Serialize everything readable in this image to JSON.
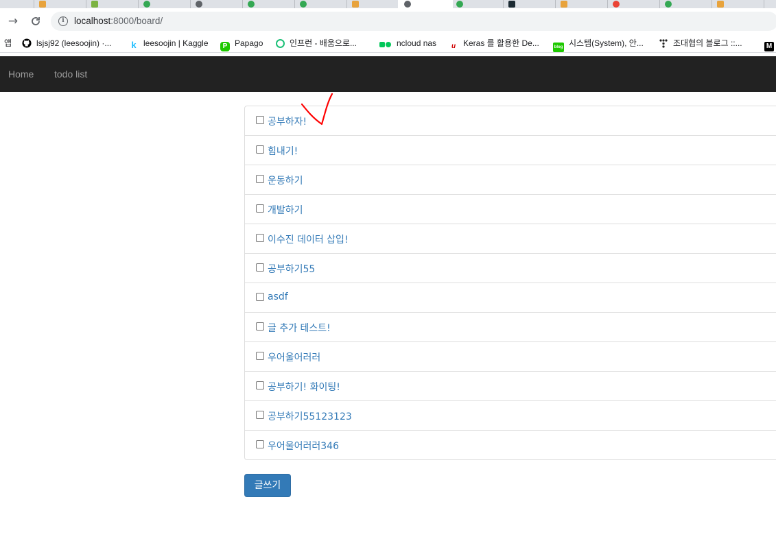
{
  "browser": {
    "url_host": "localhost",
    "url_path": ":8000/board/",
    "tab_favicon_colors": [
      "#e8a33c",
      "#e8a33c",
      "#7cb342",
      "#34a853",
      "#5f6368",
      "#34a853",
      "#34a853",
      "#e8a33c",
      "#5f6368",
      "#34a853",
      "#1c2b33",
      "#e8a33c",
      "#ea4335",
      "#34a853",
      "#e8a33c"
    ]
  },
  "bookmarks": [
    {
      "label": "앱",
      "icon": "apps-icon",
      "color": "#202124"
    },
    {
      "label": "lsjsj92 (leesoojin) ·...",
      "icon": "github-icon",
      "color": "#000000"
    },
    {
      "label": "leesoojin | Kaggle",
      "icon": "kaggle-icon",
      "color": "#20beff"
    },
    {
      "label": "Papago",
      "icon": "papago-icon",
      "color": "#1ec800"
    },
    {
      "label": "인프런 - 배움으로...",
      "icon": "inflearn-icon",
      "color": "#1dc078"
    },
    {
      "label": "ncloud nas",
      "icon": "ncloud-icon",
      "color": "#03c75a"
    },
    {
      "label": "Keras 를 활용한 De...",
      "icon": "keras-icon",
      "color": "#d00000"
    },
    {
      "label": "시스템(System), 안...",
      "icon": "blog-icon",
      "color": "#1ec800"
    },
    {
      "label": "조대협의 블로그 ::...",
      "icon": "tistory-icon",
      "color": "#202124"
    }
  ],
  "navbar": {
    "home": "Home",
    "todo": "todo list"
  },
  "todos": [
    {
      "label": "공부하자!",
      "checked": false
    },
    {
      "label": "힘내기!",
      "checked": false
    },
    {
      "label": "운동하기",
      "checked": false
    },
    {
      "label": "개발하기",
      "checked": false
    },
    {
      "label": "이수진 데이터 삽입!",
      "checked": false
    },
    {
      "label": "공부하기55",
      "checked": false
    },
    {
      "label": "asdf",
      "checked": false
    },
    {
      "label": "글 추가 테스트!",
      "checked": false
    },
    {
      "label": "우어울어러러",
      "checked": false
    },
    {
      "label": "공부하기! 화이팅!",
      "checked": false
    },
    {
      "label": "공부하기55123123",
      "checked": false
    },
    {
      "label": "우어울어러러346",
      "checked": false
    }
  ],
  "write_button": "글쓰기",
  "colors": {
    "link": "#337ab7",
    "navbar_bg": "#222222",
    "annotation": "#ff0000"
  }
}
